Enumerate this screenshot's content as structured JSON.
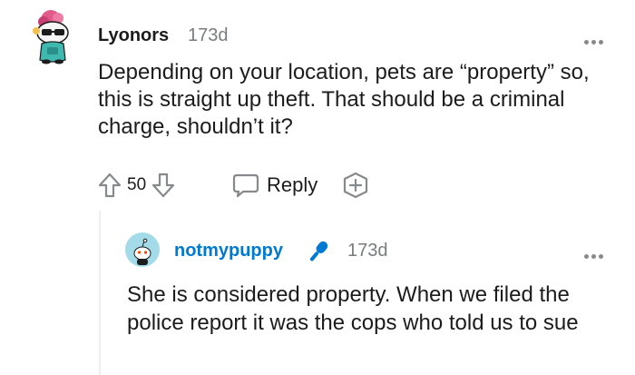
{
  "comment": {
    "username": "Lyonors",
    "age": "173d",
    "body": "Depending on your location, pets are “property” so, this is straight up theft. That should be a criminal charge, shouldn’t it?",
    "votes": "50",
    "reply_label": "Reply"
  },
  "reply": {
    "username": "notmypuppy",
    "age": "173d",
    "body": "She is considered property. When we filed the police report it was the cops who told us to sue"
  },
  "colors": {
    "username_reply": "#0079d3",
    "meta": "#787c7e",
    "icon": "#878a8c",
    "text": "#1c1c1c"
  }
}
